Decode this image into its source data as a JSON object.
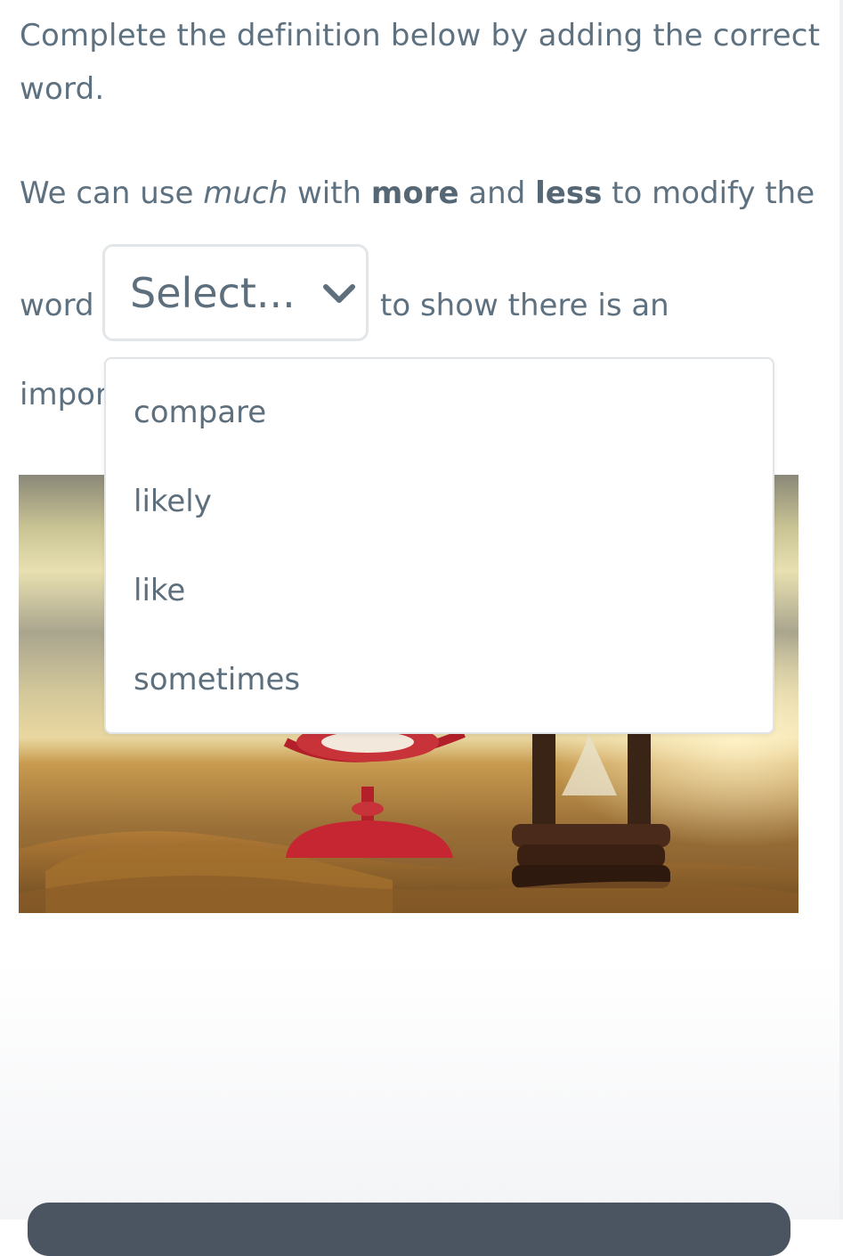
{
  "question": {
    "instruction": "Complete the definition below by adding the correct word.",
    "sentence_part1": "We can use ",
    "sentence_italic": "much",
    "sentence_part2": " with ",
    "sentence_bold1": "more",
    "sentence_part3": " and ",
    "sentence_bold2": "less",
    "sentence_part4": " to modify the",
    "sentence_word": "word",
    "sentence_after_select": "to show there is an",
    "sentence_line3_visible": "impor"
  },
  "dropdown": {
    "selected_label": "Select...",
    "icon": "chevron-down-icon",
    "expanded": true,
    "options": [
      "compare",
      "likely",
      "like",
      "sometimes"
    ]
  },
  "colors": {
    "text": "#5e7180",
    "border": "#e3e6e9",
    "button": "#4b5561"
  }
}
